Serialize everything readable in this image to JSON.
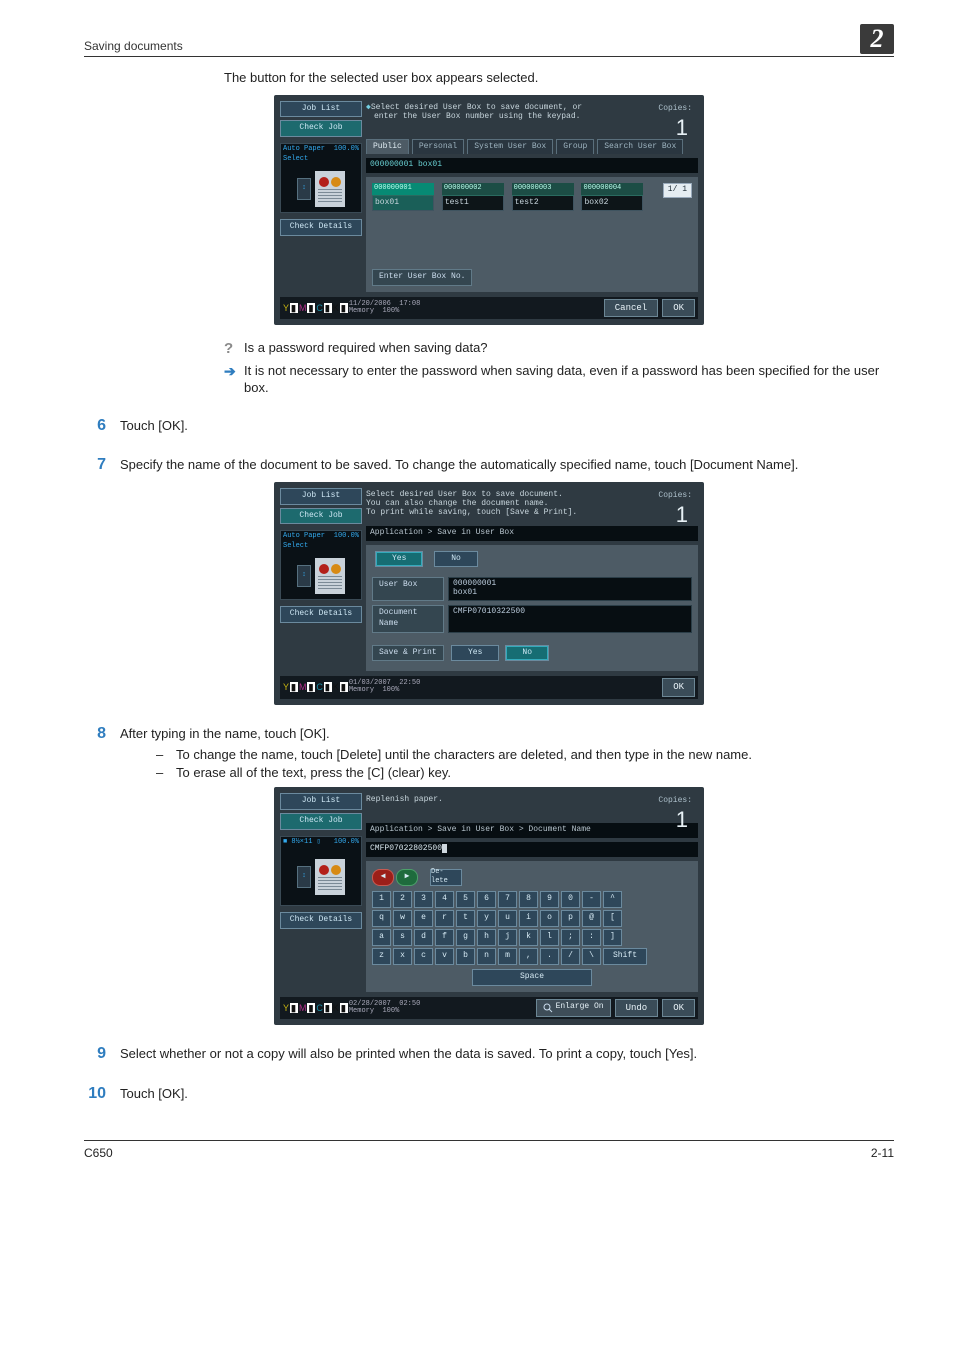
{
  "header": {
    "title": "Saving documents",
    "chapter": "2"
  },
  "intro": "The button for the selected user box appears selected.",
  "screen1": {
    "leftpane": {
      "job_list": "Job List",
      "check_job": "Check Job",
      "autopaper": "Auto Paper Select",
      "zoom": "100.0%",
      "check_details": "Check Details"
    },
    "instr_line1": "Select desired User Box to save document, or",
    "instr_line2": "enter the User Box number using the keypad.",
    "copies_label": "Copies:",
    "copies_value": "1",
    "tabs": [
      "Public",
      "Personal",
      "System User Box",
      "Group",
      "Search User Box"
    ],
    "crumb": "000000001   box01",
    "boxes": [
      {
        "num": "000000001",
        "name": "box01"
      },
      {
        "num": "000000002",
        "name": "test1"
      },
      {
        "num": "000000003",
        "name": "test2"
      },
      {
        "num": "000000004",
        "name": "box02"
      }
    ],
    "pager": "1/ 1",
    "enter_box": "Enter User Box No.",
    "status_date": "11/20/2006",
    "status_time": "17:08",
    "status_mem_lbl": "Memory",
    "status_mem_val": "100%",
    "cancel": "Cancel",
    "ok": "OK"
  },
  "qa": {
    "q": "Is a password required when saving data?",
    "a": "It is not necessary to enter the password when saving data, even if a password has been specified for the user box."
  },
  "step6": {
    "num": "6",
    "text": "Touch [OK]."
  },
  "step7": {
    "num": "7",
    "text": "Specify the name of the document to be saved. To change the automatically specified name, touch [Document Name]."
  },
  "screen2": {
    "instr1": "Select desired User Box to save document.",
    "instr2": "You can also change the document name.",
    "instr3": "To print while saving, touch [Save & Print].",
    "crumb": "Application > Save in User Box",
    "yes": "Yes",
    "no": "No",
    "userbox_lbl": "User Box",
    "userbox_val1": "000000001",
    "userbox_val2": "box01",
    "docname_lbl": "Document Name",
    "docname_val": "CMFP07010322500",
    "saveprint_lbl": "Save & Print",
    "status_date": "01/03/2007",
    "status_time": "22:50",
    "status_mem_lbl": "Memory",
    "status_mem_val": "100%",
    "ok": "OK",
    "copies_label": "Copies:",
    "copies_value": "1"
  },
  "step8": {
    "num": "8",
    "text": "After typing in the name, touch [OK].",
    "bul1": "To change the name, touch [Delete] until the characters are deleted, and then type in the new name.",
    "bul2": "To erase all of the text, press the [C] (clear) key."
  },
  "screen3": {
    "instr": "Replenish paper.",
    "crumb": "Application > Save in User Box > Document Name",
    "docname_val": "CMFP07022802500",
    "paper_size": "8½×11",
    "zoom": "100.0%",
    "delete": "De- lete",
    "row1": [
      "1",
      "2",
      "3",
      "4",
      "5",
      "6",
      "7",
      "8",
      "9",
      "0",
      "-",
      "^"
    ],
    "row2": [
      "q",
      "w",
      "e",
      "r",
      "t",
      "y",
      "u",
      "i",
      "o",
      "p",
      "@",
      "["
    ],
    "row3": [
      "a",
      "s",
      "d",
      "f",
      "g",
      "h",
      "j",
      "k",
      "l",
      ";",
      ":",
      "]"
    ],
    "row4": [
      "z",
      "x",
      "c",
      "v",
      "b",
      "n",
      "m",
      ",",
      ".",
      "/",
      "\\"
    ],
    "shift": "Shift",
    "space": "Space",
    "enlarge": "Enlarge On",
    "undo": "Undo",
    "ok": "OK",
    "status_date": "02/28/2007",
    "status_time": "02:50",
    "status_mem_lbl": "Memory",
    "status_mem_val": "100%",
    "copies_label": "Copies:",
    "copies_value": "1"
  },
  "step9": {
    "num": "9",
    "text": "Select whether or not a copy will also be printed when the data is saved. To print a copy, touch [Yes]."
  },
  "step10": {
    "num": "10",
    "text": "Touch [OK]."
  },
  "footer": {
    "left": "C650",
    "right": "2-11"
  }
}
